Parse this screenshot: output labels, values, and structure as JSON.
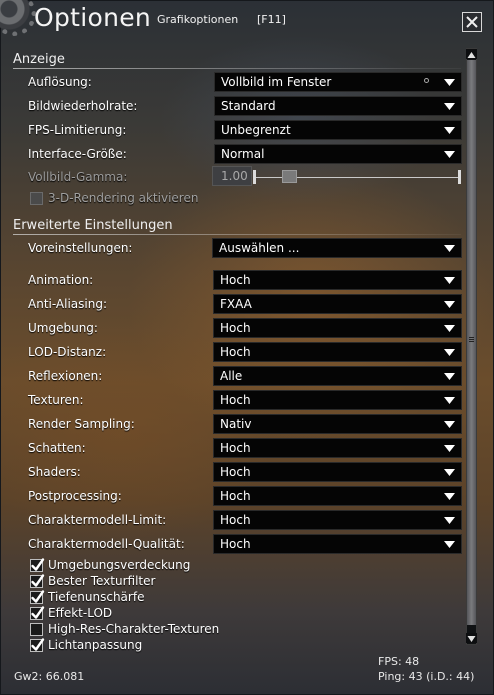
{
  "window": {
    "title": "Optionen",
    "subtitle": "Grafikoptionen",
    "hotkey": "[F11]",
    "close_icon": "close-icon"
  },
  "display": {
    "header": "Anzeige",
    "rows": [
      {
        "label": "Auflösung:",
        "value": "Vollbild im Fenster"
      },
      {
        "label": "Bildwiederholrate:",
        "value": "Standard"
      },
      {
        "label": "FPS-Limitierung:",
        "value": "Unbegrenzt"
      },
      {
        "label": "Interface-Größe:",
        "value": "Normal"
      }
    ],
    "gamma_label": "Vollbild-Gamma:",
    "gamma_value": "1.00",
    "gamma_fraction": 0.17,
    "render3d_label": "3-D-Rendering aktivieren",
    "render3d_checked": false
  },
  "advanced": {
    "header": "Erweiterte Einstellungen",
    "preset_label": "Voreinstellungen:",
    "preset_value": "Auswählen ...",
    "rows": [
      {
        "label": "Animation:",
        "value": "Hoch"
      },
      {
        "label": "Anti-Aliasing:",
        "value": "FXAA"
      },
      {
        "label": "Umgebung:",
        "value": "Hoch"
      },
      {
        "label": "LOD-Distanz:",
        "value": "Hoch"
      },
      {
        "label": "Reflexionen:",
        "value": "Alle"
      },
      {
        "label": "Texturen:",
        "value": "Hoch"
      },
      {
        "label": "Render Sampling:",
        "value": "Nativ"
      },
      {
        "label": "Schatten:",
        "value": "Hoch"
      },
      {
        "label": "Shaders:",
        "value": "Hoch"
      },
      {
        "label": "Postprocessing:",
        "value": "Hoch"
      },
      {
        "label": "Charaktermodell-Limit:",
        "value": "Hoch"
      },
      {
        "label": "Charaktermodell-Qualität:",
        "value": "Hoch"
      }
    ],
    "checkboxes": [
      {
        "label": "Umgebungsverdeckung",
        "checked": true
      },
      {
        "label": "Bester Texturfilter",
        "checked": true
      },
      {
        "label": "Tiefenunschärfe",
        "checked": true
      },
      {
        "label": "Effekt-LOD",
        "checked": true
      },
      {
        "label": "High-Res-Charakter-Texturen",
        "checked": false
      },
      {
        "label": "Lichtanpassung",
        "checked": true
      }
    ]
  },
  "footer": {
    "build": "Gw2: 66.081",
    "fps": "FPS: 48",
    "ping": "Ping: 43 (i.D.: 44)"
  },
  "colors": {
    "dropdown_bg": "#050505",
    "text": "#ffffff",
    "disabled_text": "#9b9b9b"
  }
}
